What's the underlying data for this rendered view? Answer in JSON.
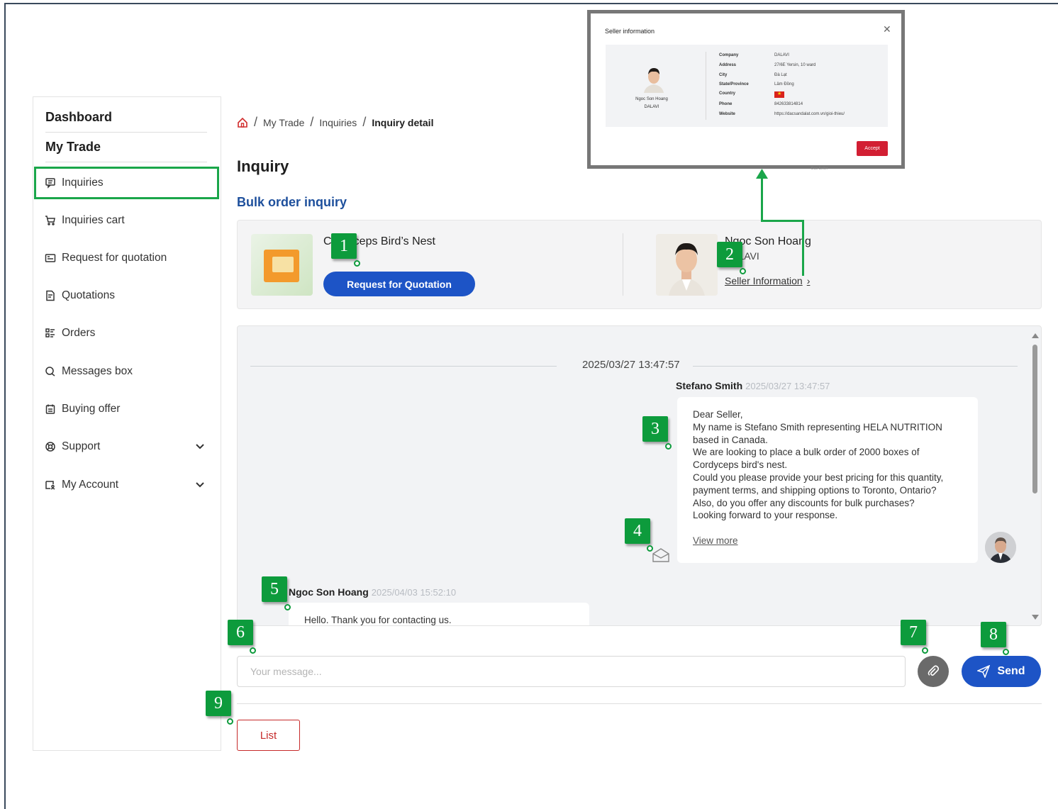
{
  "sidebar": {
    "dashboard": "Dashboard",
    "my_trade": "My Trade",
    "items": [
      {
        "label": "Inquiries",
        "icon": "message-icon"
      },
      {
        "label": "Inquiries cart",
        "icon": "cart-icon"
      },
      {
        "label": "Request for quotation",
        "icon": "quotation-request-icon"
      },
      {
        "label": "Quotations",
        "icon": "document-icon"
      },
      {
        "label": "Orders",
        "icon": "orders-icon"
      },
      {
        "label": "Messages box",
        "icon": "chat-icon"
      },
      {
        "label": "Buying offer",
        "icon": "calendar-icon"
      },
      {
        "label": "Support",
        "icon": "support-icon"
      },
      {
        "label": "My Account",
        "icon": "account-icon"
      }
    ]
  },
  "breadcrumb": {
    "items": [
      "My Trade",
      "Inquiries",
      "Inquiry detail"
    ]
  },
  "page": {
    "title": "Inquiry",
    "subtitle": "Bulk order inquiry"
  },
  "product": {
    "name": "Cordyceps Bird’s Nest",
    "rfq_button": "Request for Quotation"
  },
  "seller": {
    "name": "Ngoc Son Hoang",
    "company": "DALAVI",
    "link": "Seller Information"
  },
  "chat": {
    "date": "2025/03/27 13:47:57",
    "messages": [
      {
        "sender": "Stefano Smith",
        "time": "2025/03/27 13:47:57",
        "body": "Dear Seller,\nMy name is Stefano Smith representing HELA NUTRITION based in Canada.\nWe are looking to place a bulk order of 2000 boxes of Cordyceps bird's nest.\nCould you please provide your best pricing for this quantity, payment terms, and shipping options to Toronto, Ontario?\nAlso, do you offer any discounts for bulk purchases?\nLooking forward to your response.",
        "view_more": "View more"
      },
      {
        "sender": "Ngoc Son Hoang",
        "time": "2025/04/03 15:52:10",
        "body": "Hello. Thank you for contacting us."
      }
    ]
  },
  "composer": {
    "placeholder": "Your message...",
    "send_label": "Send"
  },
  "list_button": "List",
  "modal": {
    "title": "Seller information",
    "seller_name": "Ngoc Son Hoang",
    "seller_company": "DALAVI",
    "fields": [
      {
        "key": "Company",
        "value": "DALAVI"
      },
      {
        "key": "Address",
        "value": "27/6E Yersin, 10 ward"
      },
      {
        "key": "City",
        "value": "Đà Lạt"
      },
      {
        "key": "State/Province",
        "value": "Lâm Đồng"
      },
      {
        "key": "Country",
        "value": ""
      },
      {
        "key": "Phone",
        "value": "842633814814"
      },
      {
        "key": "Website",
        "value": "https://dacsandalat.com.vn/gioi-thieu/"
      }
    ],
    "accept": "Accept",
    "peek_text": "Dao Seller"
  },
  "callouts": [
    "1",
    "2",
    "3",
    "4",
    "5",
    "6",
    "7",
    "8",
    "9"
  ],
  "colors": {
    "accent_blue": "#1d54c6",
    "callout_green": "#0d9b3c",
    "danger_red": "#c62a2a"
  }
}
